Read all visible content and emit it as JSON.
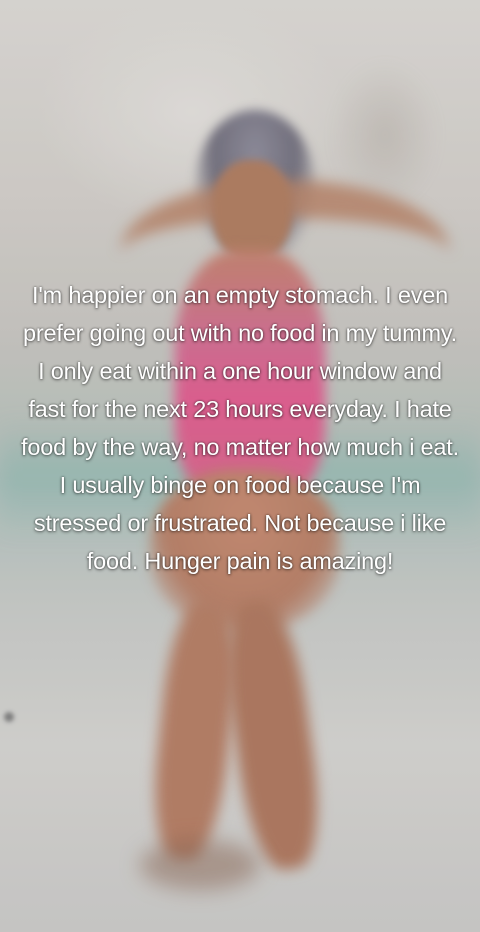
{
  "video": {
    "caption": "I'm happier on an empty stomach. I even prefer going out with no food in my tummy. I only eat within a one hour window and fast for the next 23 hours everyday. I hate food by the way, no matter how much i eat. I usually binge on food because I'm stressed or frustrated. Not because i like food. Hunger pain is amazing!",
    "caption_color": "#ffffff"
  }
}
